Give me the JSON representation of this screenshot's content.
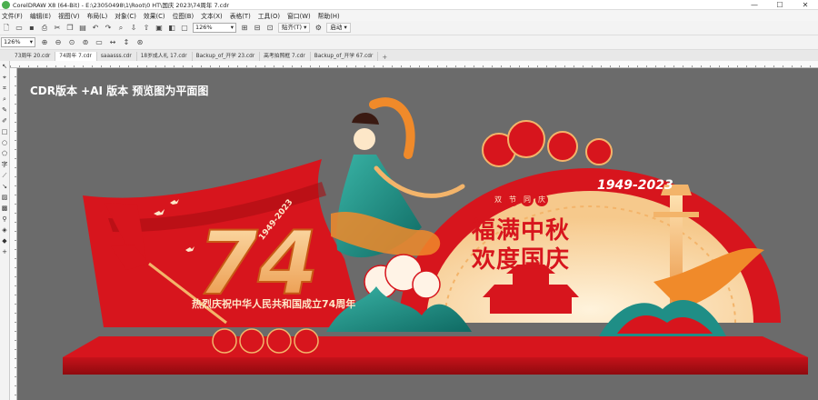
{
  "window": {
    "title": "CorelDRAW X8 (64-Bit) - E:\\23050498\\1\\Root\\0 HT\\国庆 2023\\74周年 7.cdr",
    "controls": [
      "—",
      "☐",
      "✕"
    ]
  },
  "menu": [
    "文件(F)",
    "编辑(E)",
    "视图(V)",
    "布局(L)",
    "对象(C)",
    "效果(C)",
    "位图(B)",
    "文本(X)",
    "表格(T)",
    "工具(O)",
    "窗口(W)",
    "帮助(H)"
  ],
  "toolbar": {
    "zoom_value": "126%",
    "snap_label": "贴齐(T)",
    "launch_label": "启动"
  },
  "propbar": {
    "zoom_value": "126%"
  },
  "tabs": [
    {
      "label": "73周年 20.cdr",
      "active": false
    },
    {
      "label": "74周年 7.cdr",
      "active": true
    },
    {
      "label": "saaasss.cdr",
      "active": false
    },
    {
      "label": "18岁成人礼 17.cdr",
      "active": false
    },
    {
      "label": "Backup_of_开学 23.cdr",
      "active": false
    },
    {
      "label": "高考拍照框 7.cdr",
      "active": false
    },
    {
      "label": "Backup_of_开学 67.cdr",
      "active": false
    }
  ],
  "canvas": {
    "note": "CDR版本 +AI 版本   预览图为平面图",
    "artwork": {
      "big_number": "74",
      "year_range_small": "1949-2023",
      "subtitle": "热烈庆祝中华人民共和国成立74周年",
      "year_range_large": "1949-2023",
      "badge_chars": [
        "双",
        "节",
        "同",
        "庆"
      ],
      "headline_1": "福满中秋",
      "headline_2": "欢度国庆"
    }
  },
  "colors": {
    "canvas_bg": "#6b6b6b",
    "red": "#d7151d",
    "dark_red": "#a80d12",
    "gold": "#f3b46a",
    "cream": "#fde7c8",
    "teal": "#1f8e86"
  }
}
